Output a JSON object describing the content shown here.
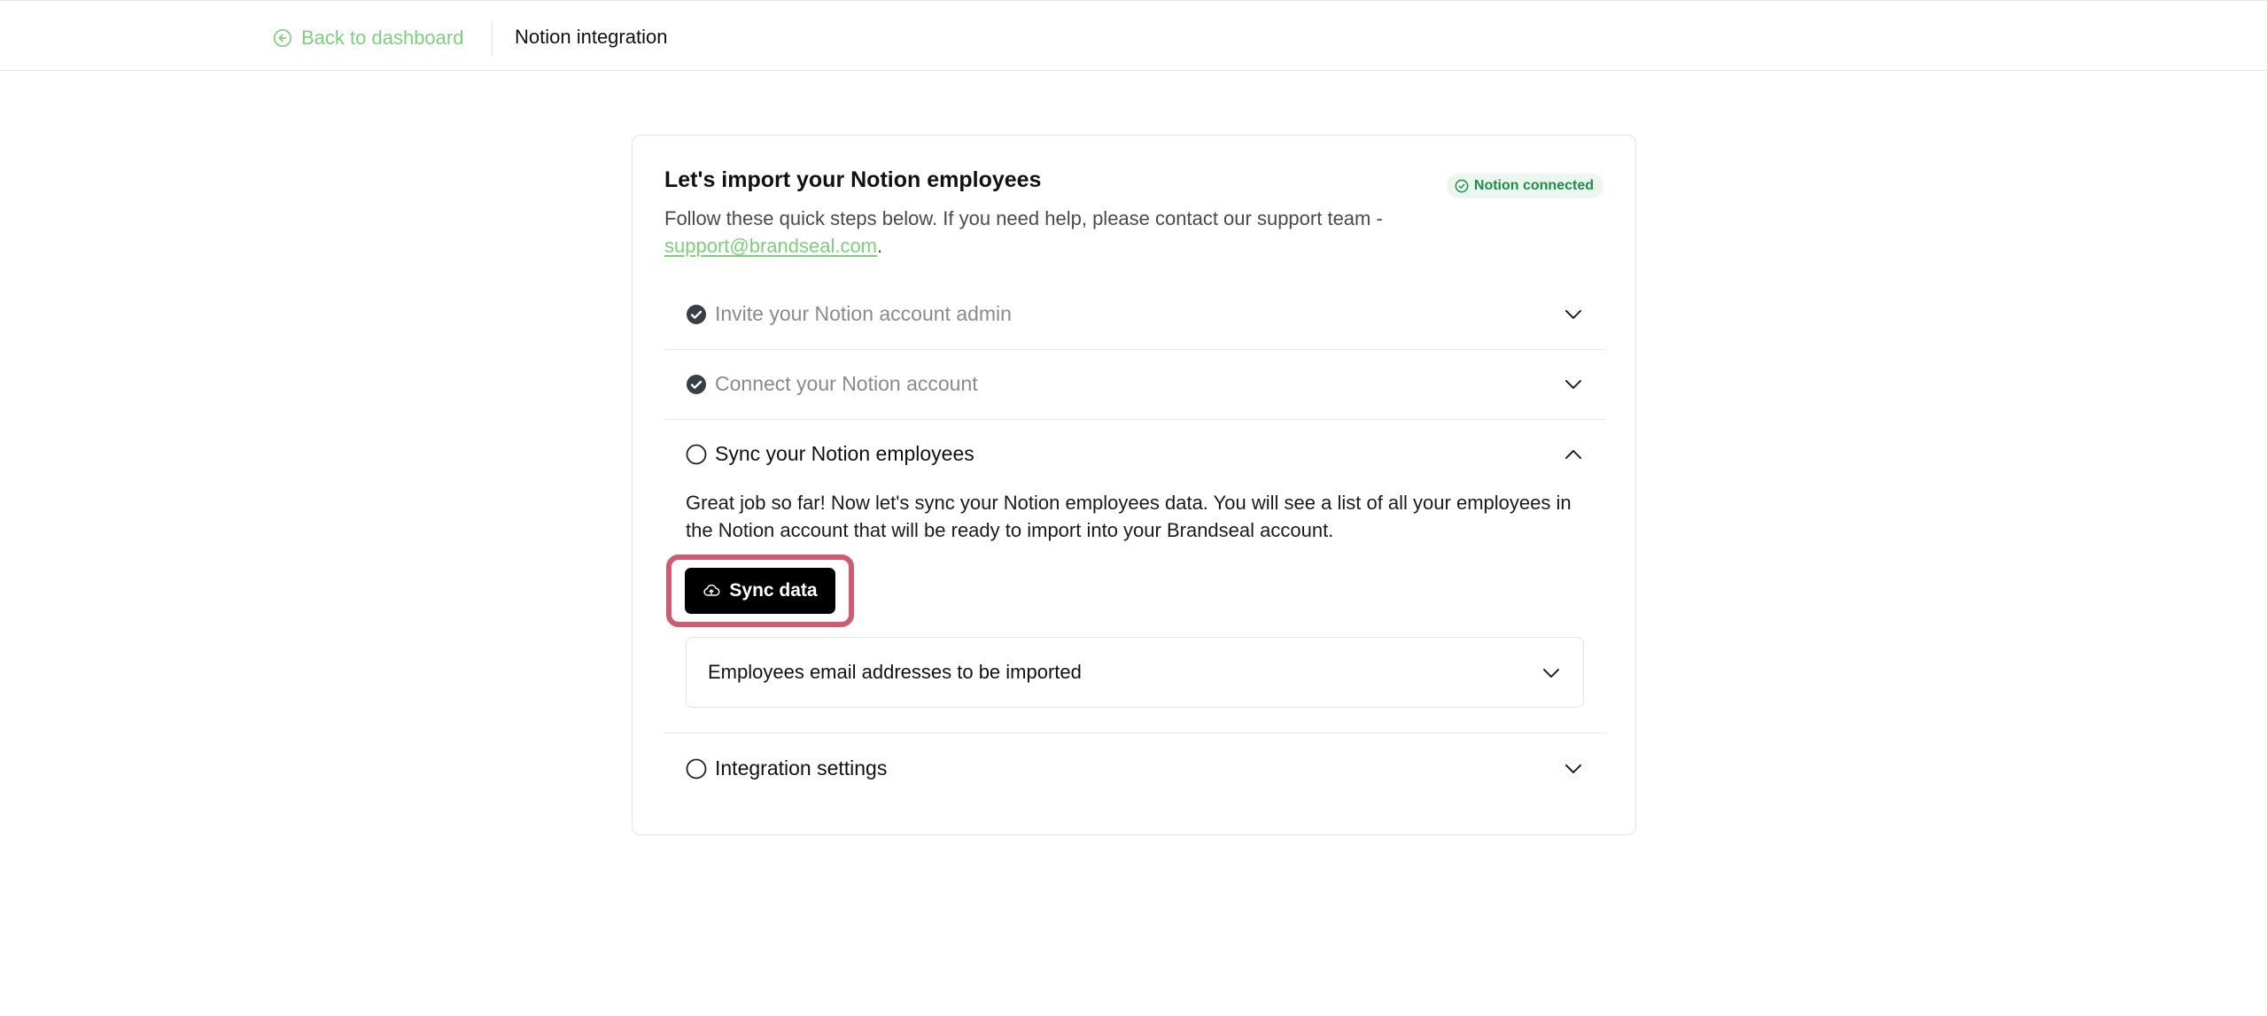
{
  "topbar": {
    "back_label": "Back to dashboard",
    "page_title": "Notion integration"
  },
  "card": {
    "title": "Let's import your Notion employees",
    "badge": "Notion connected",
    "desc_prefix": "Follow these quick steps below. If you need help, please contact our support team - ",
    "support_email": "support@brandseal.com",
    "desc_suffix": "."
  },
  "steps": [
    {
      "label": "Invite your Notion account admin",
      "status": "done",
      "expanded": false
    },
    {
      "label": "Connect your Notion account",
      "status": "done",
      "expanded": false
    },
    {
      "label": "Sync your Notion employees",
      "status": "active",
      "expanded": true,
      "body": "Great job so far! Now let's sync your Notion employees data. You will see a list of all your employees in the Notion account that will be ready to import into your Brandseal account.",
      "button_label": "Sync data",
      "panel_label": "Employees email addresses to be imported"
    },
    {
      "label": "Integration settings",
      "status": "pending",
      "expanded": false
    }
  ],
  "colors": {
    "accent_green": "#7dcf7b",
    "badge_bg": "#eaf7ee",
    "badge_text": "#1f8b4c",
    "highlight": "#cf5b71"
  }
}
